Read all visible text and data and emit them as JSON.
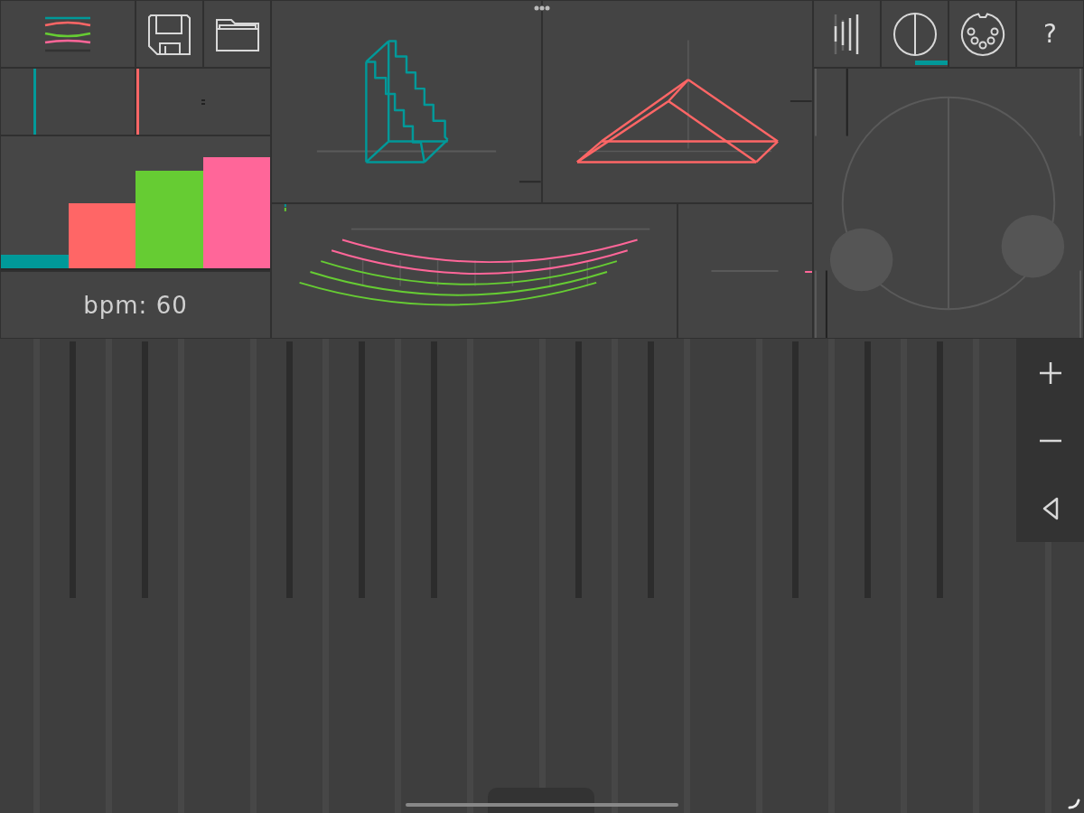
{
  "tabs": [
    {
      "selected": false
    },
    {
      "selected": true
    },
    {
      "selected": false
    },
    {
      "label": "?",
      "selected": false
    }
  ],
  "meter": {
    "bars": [
      {
        "color": "#009999",
        "level": 0.1
      },
      {
        "color": "#ff6666",
        "level": 0.49
      },
      {
        "color": "#66cc33",
        "level": 0.74
      },
      {
        "color": "#ff6699",
        "level": 0.84
      }
    ]
  },
  "tempo": {
    "text": "bpm: 60"
  }
}
